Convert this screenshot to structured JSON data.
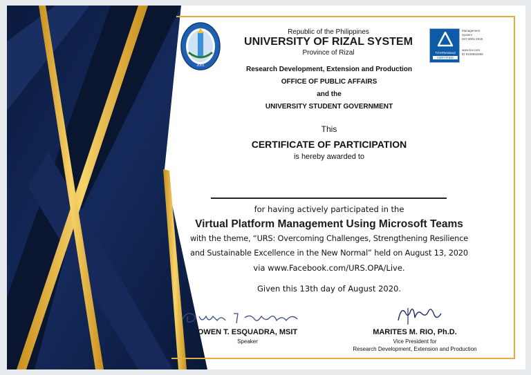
{
  "header": {
    "republic": "Republic of the Philippines",
    "university": "UNIVERSITY OF RIZAL SYSTEM",
    "province": "Province of Rizal"
  },
  "offices": {
    "line1": "Research Development, Extension and Production",
    "line2": "OFFICE OF PUBLIC AFFAIRS",
    "line3": "and the",
    "line4": "UNIVERSITY STUDENT GOVERNMENT"
  },
  "certificate": {
    "this": "This",
    "title": "CERTIFICATE OF PARTICIPATION",
    "awarded": "is hereby awarded to",
    "participation": "for having actively participated in the",
    "event": "Virtual Platform Management Using Microsoft Teams",
    "theme1": "with the theme, “URS: Overcoming Challenges, Strengthening Resilience",
    "theme2": "and Sustainable Excellence in the New Normal” held on August 13, 2020",
    "via": "via www.Facebook.com/URS.OPA/Live.",
    "given": "Given this 13th day of August 2020."
  },
  "signatories": {
    "left": {
      "name": "OWEN T. ESQUADRA, MSIT",
      "role": "Speaker"
    },
    "right": {
      "name": "MARITES M. RIO, Ph.D.",
      "role1": "Vice President for",
      "role2": "Research  Development, Extension and Production"
    }
  },
  "seal": {
    "year": "2001"
  },
  "tuv": {
    "brand": "TÜVRheinland",
    "cert": "CERTIFIED",
    "side1": "Management",
    "side2": "System",
    "side3": "ISO 9001:2015",
    "side4": "www.tuv.com",
    "side5": "ID 9108652606"
  },
  "colors": {
    "navy": "#0e1f46",
    "gold": "#e2ad3b",
    "seal_blue": "#1f5fb0"
  }
}
